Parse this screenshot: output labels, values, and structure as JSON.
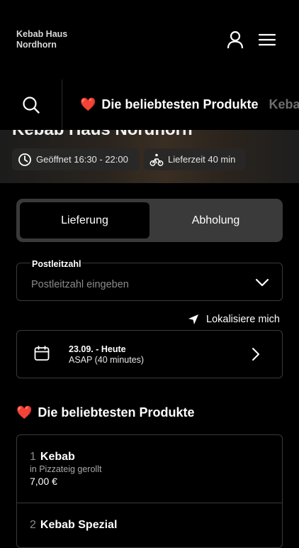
{
  "header": {
    "brand_line1": "Kebab Haus",
    "brand_line2": "Nordhorn",
    "user_icon": "user-icon",
    "menu_icon": "hamburger-menu-icon"
  },
  "category_bar": {
    "search_icon": "search-icon",
    "active_emoji": "❤️",
    "active_label": "Die beliebtesten Produkte",
    "next_label": "Keba"
  },
  "hero": {
    "title": "Kebab Haus Nordhorn",
    "open_hours": "Geöffnet 16:30 - 22:00",
    "delivery_time": "Lieferzeit 40 min"
  },
  "order_mode": {
    "delivery_label": "Lieferung",
    "pickup_label": "Abholung",
    "selected": "Lieferung"
  },
  "postal_code": {
    "label": "Postleitzahl",
    "placeholder": "Postleitzahl eingeben",
    "value": ""
  },
  "locate": {
    "label": "Lokalisiere mich"
  },
  "schedule": {
    "date": "23.09. - Heute",
    "time": "ASAP (40 minutes)"
  },
  "popular": {
    "emoji": "❤️",
    "title": "Die beliebtesten Produkte",
    "products": [
      {
        "number": "1",
        "name": "Kebab",
        "description": "in Pizzateig gerollt",
        "price": "7,00 €"
      },
      {
        "number": "2",
        "name": "Kebab Spezial"
      }
    ]
  },
  "colors": {
    "background": "#000000",
    "surface": "#3a3a3a",
    "border": "#3a3a3a",
    "text": "#ffffff",
    "muted": "#8a8a8a"
  }
}
